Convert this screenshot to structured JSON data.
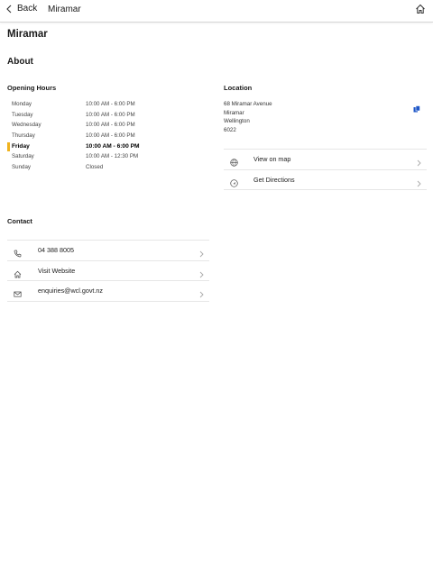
{
  "nav": {
    "back_label": "Back",
    "title": "Miramar"
  },
  "page": {
    "title": "Miramar",
    "section": "About"
  },
  "opening_hours": {
    "title": "Opening Hours",
    "rows": [
      {
        "day": "Monday",
        "time": "10:00 AM - 6:00 PM"
      },
      {
        "day": "Tuesday",
        "time": "10:00 AM - 6:00 PM"
      },
      {
        "day": "Wednesday",
        "time": "10:00 AM - 6:00 PM"
      },
      {
        "day": "Thursday",
        "time": "10:00 AM - 6:00 PM"
      },
      {
        "day": "Friday",
        "time": "10:00 AM - 6:00 PM"
      },
      {
        "day": "Saturday",
        "time": "10:00 AM - 12:30 PM"
      },
      {
        "day": "Sunday",
        "time": "Closed"
      }
    ],
    "today": "Friday",
    "highlight_color": "#f0b31e"
  },
  "location": {
    "title": "Location",
    "address": [
      "68 Miramar Avenue",
      "Miramar",
      "Wellington",
      "6022"
    ],
    "actions": [
      {
        "icon": "globe-icon",
        "label": "View on map"
      },
      {
        "icon": "directions-icon",
        "label": "Get Directions"
      }
    ]
  },
  "contact": {
    "title": "Contact",
    "items": [
      {
        "icon": "phone-icon",
        "label": "04 388 8005"
      },
      {
        "icon": "home-icon",
        "label": "Visit Website"
      },
      {
        "icon": "mail-icon",
        "label": "enquiries@wcl.govt.nz"
      }
    ]
  },
  "colors": {
    "accent_blue": "#1f57c8"
  }
}
